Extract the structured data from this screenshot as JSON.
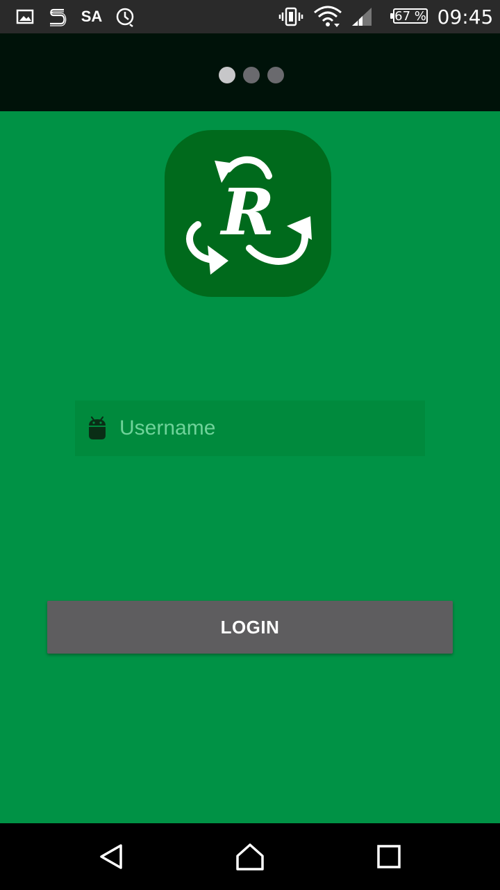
{
  "status_bar": {
    "carrier_label": "SA",
    "battery_text": "67 %",
    "time": "09:45",
    "icons": [
      "gallery-icon",
      "s-app-icon",
      "alarm-icon",
      "vibrate-icon",
      "wifi-icon",
      "signal-icon",
      "battery-icon"
    ]
  },
  "pager": {
    "page_count": 3,
    "active_index": 0
  },
  "logo": {
    "letter": "R",
    "icon": "recycle-arrows-icon"
  },
  "form": {
    "username_placeholder": "Username",
    "username_value": "",
    "username_icon": "android-icon",
    "login_label": "LOGIN"
  },
  "nav_bar": {
    "icons": [
      "back-icon",
      "home-icon",
      "recents-icon"
    ]
  },
  "colors": {
    "background": "#009245",
    "logo_bg": "#006a1c",
    "field_bg": "#008a3d",
    "button_bg": "#5e5d5f",
    "placeholder": "#6fd39a"
  }
}
